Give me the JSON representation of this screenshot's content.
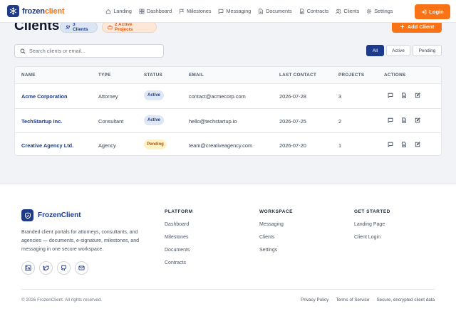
{
  "navbar": {
    "brand_main": "frozen",
    "brand_accent": "client",
    "items": [
      {
        "label": "Landing",
        "icon": "home-icon"
      },
      {
        "label": "Dashboard",
        "icon": "dashboard-icon"
      },
      {
        "label": "Milestones",
        "icon": "flag-icon"
      },
      {
        "label": "Messaging",
        "icon": "chat-icon"
      },
      {
        "label": "Documents",
        "icon": "document-icon"
      },
      {
        "label": "Contracts",
        "icon": "signature-icon"
      },
      {
        "label": "Clients",
        "icon": "users-icon"
      },
      {
        "label": "Settings",
        "icon": "gear-icon"
      }
    ],
    "login_label": "Login"
  },
  "header": {
    "title": "Clients",
    "clients_pill": "3 Clients",
    "projects_pill": "2 Active Projects",
    "add_label": "Add Client"
  },
  "search": {
    "placeholder": "Search clients or email..."
  },
  "filters": {
    "all": "All",
    "active": "Active",
    "pending": "Pending",
    "selected": "All"
  },
  "table": {
    "columns": [
      "NAME",
      "TYPE",
      "STATUS",
      "EMAIL",
      "LAST CONTACT",
      "PROJECTS",
      "ACTIONS"
    ],
    "rows": [
      {
        "name": "Acme Corporation",
        "type": "Attorney",
        "status": "Active",
        "email": "contact@acmecorp.com",
        "last_contact": "2026-07-28",
        "projects": "3"
      },
      {
        "name": "TechStartup Inc.",
        "type": "Consultant",
        "status": "Active",
        "email": "hello@techstartup.io",
        "last_contact": "2026-07-25",
        "projects": "2"
      },
      {
        "name": "Creative Agency Ltd.",
        "type": "Agency",
        "status": "Pending",
        "email": "team@creativeagency.com",
        "last_contact": "2026-07-20",
        "projects": "1"
      }
    ]
  },
  "footer": {
    "brand": "FrozenClient",
    "description": "Branded client portals for attorneys, consultants, and agencies — documents, e-signature, milestones, and messaging in one secure workspace.",
    "socials": [
      "linkedin-icon",
      "twitter-icon",
      "github-icon",
      "mail-icon"
    ],
    "platform": {
      "title": "PLATFORM",
      "links": [
        "Dashboard",
        "Milestones",
        "Documents",
        "Contracts"
      ]
    },
    "workspace": {
      "title": "WORKSPACE",
      "links": [
        "Messaging",
        "Clients",
        "Settings"
      ]
    },
    "get_started": {
      "title": "GET STARTED",
      "links": [
        "Landing Page",
        "Client Login"
      ]
    },
    "copyright": "© 2026 FrozenClient. All rights reserved.",
    "legal": [
      "Privacy Policy",
      "Terms of Service",
      "Secure, encrypted client data"
    ]
  },
  "colors": {
    "primary": "#1e3a8a",
    "accent": "#f97316"
  }
}
